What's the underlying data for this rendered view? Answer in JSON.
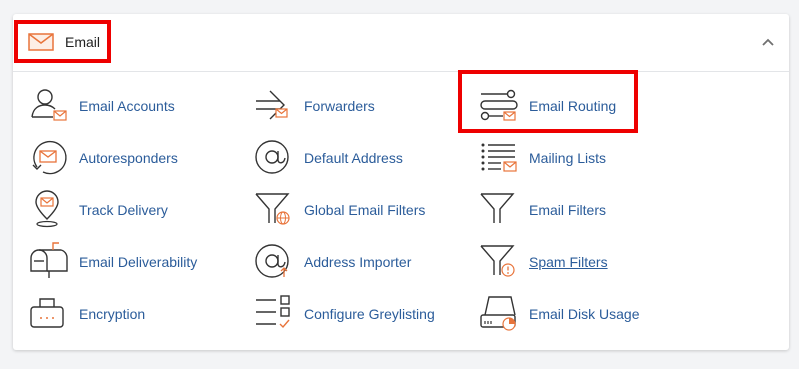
{
  "section": {
    "title": "Email",
    "collapse_icon": "chevron-up-icon",
    "accent_color": "#e8743b",
    "link_color": "#2b5c9a",
    "highlight_color": "#ee0000"
  },
  "items": [
    {
      "label": "Email Accounts",
      "icon": "email-accounts-icon"
    },
    {
      "label": "Forwarders",
      "icon": "forwarders-icon"
    },
    {
      "label": "Email Routing",
      "icon": "email-routing-icon"
    },
    {
      "label": "Autoresponders",
      "icon": "autoresponders-icon"
    },
    {
      "label": "Default Address",
      "icon": "default-address-icon"
    },
    {
      "label": "Mailing Lists",
      "icon": "mailing-lists-icon"
    },
    {
      "label": "Track Delivery",
      "icon": "track-delivery-icon"
    },
    {
      "label": "Global Email Filters",
      "icon": "global-email-filters-icon"
    },
    {
      "label": "Email Filters",
      "icon": "email-filters-icon"
    },
    {
      "label": "Email Deliverability",
      "icon": "email-deliverability-icon"
    },
    {
      "label": "Address Importer",
      "icon": "address-importer-icon"
    },
    {
      "label": "Spam Filters",
      "icon": "spam-filters-icon"
    },
    {
      "label": "Encryption",
      "icon": "encryption-icon"
    },
    {
      "label": "Configure Greylisting",
      "icon": "configure-greylisting-icon"
    },
    {
      "label": "Email Disk Usage",
      "icon": "email-disk-usage-icon"
    }
  ]
}
